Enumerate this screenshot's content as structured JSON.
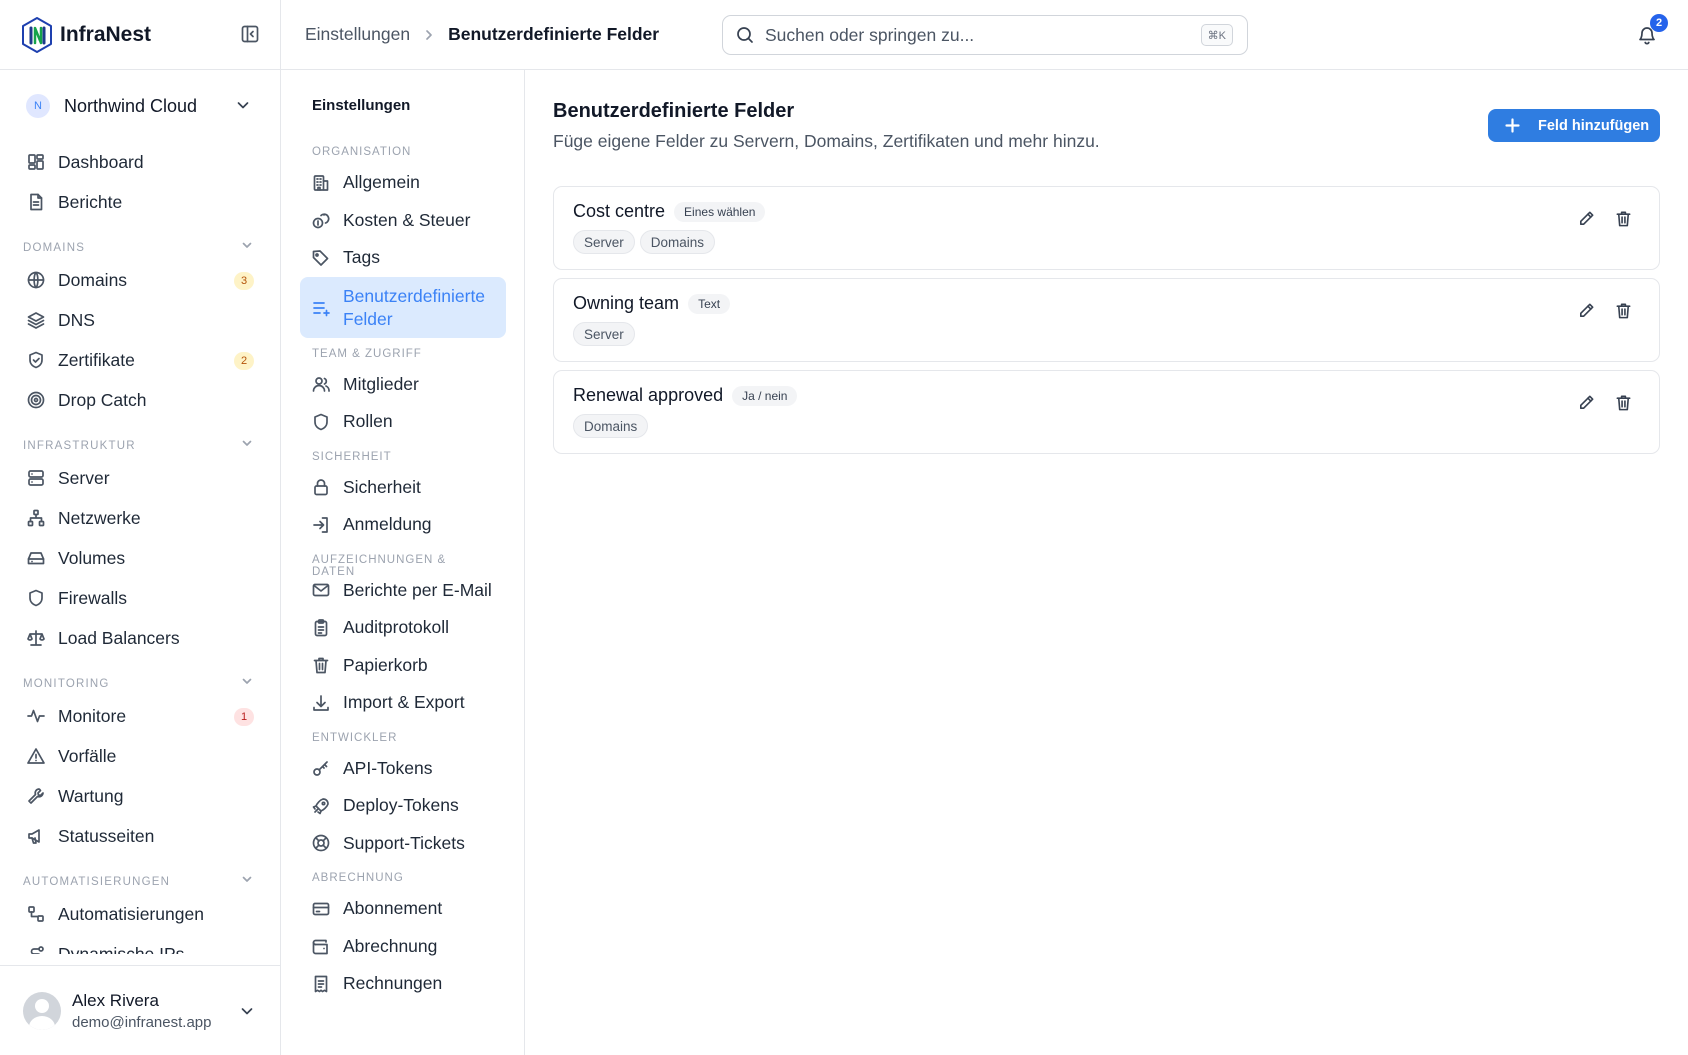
{
  "brand": {
    "name": "InfraNest"
  },
  "org": {
    "initial": "N",
    "name": "Northwind Cloud"
  },
  "sidebar": {
    "top_items": [
      {
        "label": "Dashboard",
        "icon": "dashboard-icon"
      },
      {
        "label": "Berichte",
        "icon": "report-icon"
      }
    ],
    "sections": [
      {
        "title": "DOMAINS",
        "items": [
          {
            "label": "Domains",
            "icon": "globe-icon",
            "badge": "3",
            "badge_color": "#b45309"
          },
          {
            "label": "DNS",
            "icon": "layers-icon"
          },
          {
            "label": "Zertifikate",
            "icon": "shield-check-icon",
            "badge": "2",
            "badge_color": "#b45309"
          },
          {
            "label": "Drop Catch",
            "icon": "target-icon"
          }
        ]
      },
      {
        "title": "INFRASTRUKTUR",
        "items": [
          {
            "label": "Server",
            "icon": "server-icon"
          },
          {
            "label": "Netzwerke",
            "icon": "network-icon"
          },
          {
            "label": "Volumes",
            "icon": "drive-icon"
          },
          {
            "label": "Firewalls",
            "icon": "shield-icon"
          },
          {
            "label": "Load Balancers",
            "icon": "scale-icon"
          }
        ]
      },
      {
        "title": "MONITORING",
        "items": [
          {
            "label": "Monitore",
            "icon": "activity-icon",
            "badge": "1",
            "badge_color": "#b91c1c"
          },
          {
            "label": "Vorfälle",
            "icon": "alert-triangle-icon"
          },
          {
            "label": "Wartung",
            "icon": "wrench-icon"
          },
          {
            "label": "Statusseiten",
            "icon": "megaphone-icon"
          }
        ]
      },
      {
        "title": "AUTOMATISIERUNGEN",
        "items": [
          {
            "label": "Automatisierungen",
            "icon": "workflow-icon"
          },
          {
            "label": "Dynamische IPs",
            "icon": "route-icon"
          }
        ]
      }
    ]
  },
  "user": {
    "name": "Alex Rivera",
    "email": "demo@infranest.app"
  },
  "topbar": {
    "breadcrumb": [
      "Einstellungen",
      "Benutzerdefinierte Felder"
    ],
    "search_placeholder": "Suchen oder springen zu...",
    "shortcut": "⌘K",
    "notification_count": "2"
  },
  "settings_nav": {
    "title": "Einstellungen",
    "sections": [
      {
        "title": "ORGANISATION",
        "items": [
          {
            "label": "Allgemein",
            "icon": "building-icon"
          },
          {
            "label": "Kosten & Steuer",
            "icon": "coins-icon"
          },
          {
            "label": "Tags",
            "icon": "tag-icon"
          },
          {
            "label": "Benutzerdefinierte Felder",
            "icon": "list-plus-icon",
            "active": true
          }
        ]
      },
      {
        "title": "TEAM & ZUGRIFF",
        "items": [
          {
            "label": "Mitglieder",
            "icon": "users-icon"
          },
          {
            "label": "Rollen",
            "icon": "shield-icon"
          }
        ]
      },
      {
        "title": "SICHERHEIT",
        "items": [
          {
            "label": "Sicherheit",
            "icon": "lock-icon"
          },
          {
            "label": "Anmeldung",
            "icon": "log-in-icon"
          }
        ]
      },
      {
        "title": "AUFZEICHNUNGEN & DATEN",
        "items": [
          {
            "label": "Berichte per E-Mail",
            "icon": "mail-icon"
          },
          {
            "label": "Auditprotokoll",
            "icon": "clipboard-icon"
          },
          {
            "label": "Papierkorb",
            "icon": "trash-icon"
          },
          {
            "label": "Import & Export",
            "icon": "download-icon"
          }
        ]
      },
      {
        "title": "ENTWICKLER",
        "items": [
          {
            "label": "API-Tokens",
            "icon": "key-icon"
          },
          {
            "label": "Deploy-Tokens",
            "icon": "rocket-icon"
          },
          {
            "label": "Support-Tickets",
            "icon": "lifebuoy-icon"
          }
        ]
      },
      {
        "title": "ABRECHNUNG",
        "items": [
          {
            "label": "Abonnement",
            "icon": "credit-card-icon"
          },
          {
            "label": "Abrechnung",
            "icon": "wallet-icon"
          },
          {
            "label": "Rechnungen",
            "icon": "receipt-icon"
          }
        ]
      }
    ]
  },
  "main": {
    "title": "Benutzerdefinierte Felder",
    "subtitle": "Füge eigene Felder zu Servern, Domains, Zertifikaten und mehr hinzu.",
    "add_button": "Feld hinzufügen",
    "fields": [
      {
        "name": "Cost centre",
        "type": "Eines wählen",
        "targets": [
          "Server",
          "Domains"
        ]
      },
      {
        "name": "Owning team",
        "type": "Text",
        "targets": [
          "Server"
        ]
      },
      {
        "name": "Renewal approved",
        "type": "Ja / nein",
        "targets": [
          "Domains"
        ]
      }
    ]
  },
  "colors": {
    "accent": "#2f7de1",
    "active_bg": "#dbeafe",
    "active_text": "#3b82f6"
  }
}
